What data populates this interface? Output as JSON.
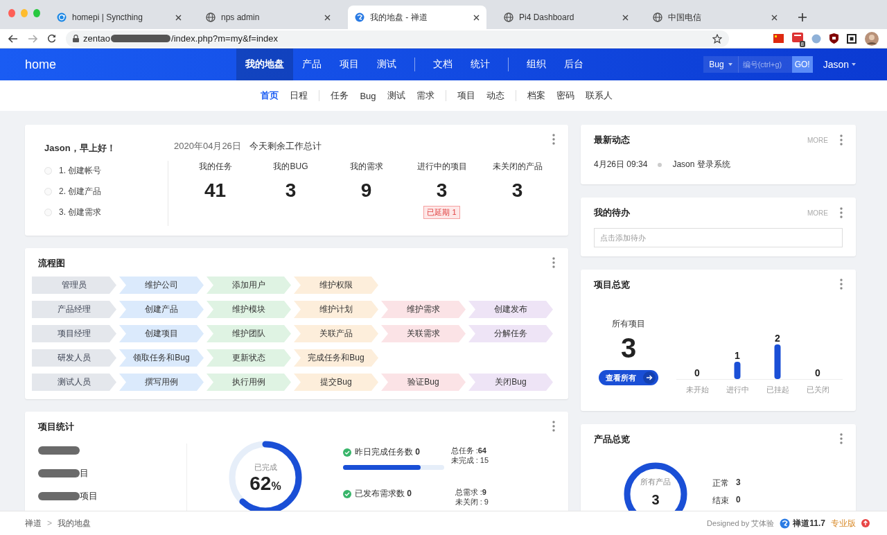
{
  "browser": {
    "tabs": [
      {
        "title": "homepi | Syncthing",
        "kind": "syncthing",
        "selected": false
      },
      {
        "title": "nps admin",
        "kind": "globe",
        "selected": false
      },
      {
        "title": "我的地盘 - 禅道",
        "kind": "zentao",
        "selected": true
      },
      {
        "title": "Pi4 Dashboard",
        "kind": "globe",
        "selected": false
      },
      {
        "title": "中国电信",
        "kind": "globe",
        "selected": false
      }
    ],
    "url": {
      "start": "zentao",
      "redacted": true,
      "path": "/index.php?m=my&f=index"
    },
    "extension_badge": "8"
  },
  "header": {
    "brand": "home",
    "nav_groups": [
      [
        {
          "label": "我的地盘",
          "selected": true
        },
        {
          "label": "产品",
          "selected": false
        },
        {
          "label": "项目",
          "selected": false
        },
        {
          "label": "测试",
          "selected": false
        }
      ],
      [
        {
          "label": "文档",
          "selected": false
        },
        {
          "label": "统计",
          "selected": false
        }
      ],
      [
        {
          "label": "组织",
          "selected": false
        },
        {
          "label": "后台",
          "selected": false
        }
      ]
    ],
    "search": {
      "type": "Bug",
      "placeholder": "编号(ctrl+g)",
      "button": "GO!"
    },
    "user": "Jason"
  },
  "subnav": {
    "groups": [
      [
        {
          "label": "首页",
          "selected": true
        },
        {
          "label": "日程",
          "selected": false
        }
      ],
      [
        {
          "label": "任务",
          "selected": false
        },
        {
          "label": "Bug",
          "selected": false
        },
        {
          "label": "测试",
          "selected": false
        },
        {
          "label": "需求",
          "selected": false
        }
      ],
      [
        {
          "label": "项目",
          "selected": false
        },
        {
          "label": "动态",
          "selected": false
        }
      ],
      [
        {
          "label": "档案",
          "selected": false
        },
        {
          "label": "密码",
          "selected": false
        },
        {
          "label": "联系人",
          "selected": false
        }
      ]
    ]
  },
  "welcome": {
    "greeting": "Jason，早上好！",
    "steps": [
      {
        "label": "1. 创建帐号",
        "done": false
      },
      {
        "label": "2. 创建产品",
        "done": false
      },
      {
        "label": "3. 创建需求",
        "done": false
      }
    ],
    "date": "2020年04月26日",
    "summary_title": "今天剩余工作总计",
    "stats": [
      {
        "label": "我的任务",
        "value": "41"
      },
      {
        "label": "我的BUG",
        "value": "3"
      },
      {
        "label": "我的需求",
        "value": "9"
      },
      {
        "label": "进行中的项目",
        "value": "3",
        "badge": "已延期 1"
      },
      {
        "label": "未关闭的产品",
        "value": "3"
      }
    ]
  },
  "flowchart": {
    "title": "流程图",
    "rows": [
      {
        "role": "管理员",
        "steps": [
          "维护公司",
          "添加用户",
          "维护权限"
        ]
      },
      {
        "role": "产品经理",
        "steps": [
          "创建产品",
          "维护模块",
          "维护计划",
          "维护需求",
          "创建发布"
        ]
      },
      {
        "role": "项目经理",
        "steps": [
          "创建项目",
          "维护团队",
          "关联产品",
          "关联需求",
          "分解任务"
        ]
      },
      {
        "role": "研发人员",
        "steps": [
          "领取任务和Bug",
          "更新状态",
          "完成任务和Bug"
        ]
      },
      {
        "role": "测试人员",
        "steps": [
          "撰写用例",
          "执行用例",
          "提交Bug",
          "验证Bug",
          "关闭Bug"
        ]
      }
    ]
  },
  "project_stats": {
    "title": "项目统计",
    "projects": [
      {
        "redacted": true
      },
      {
        "redacted": true,
        "name": "目"
      },
      {
        "redacted": true,
        "name": "项目"
      }
    ],
    "progress": {
      "label": "已完成",
      "percent": "62",
      "unit": "%",
      "level": 0.62
    },
    "metrics": [
      {
        "text": "昨日完成任务数 **0**",
        "level": 0.77,
        "totals": [
          "总任务 :**64**",
          "未完成 : 15"
        ]
      },
      {
        "text": "已发布需求数 **0**",
        "totals": [
          "总需求 :**9**",
          "未关闭 : 9"
        ]
      }
    ]
  },
  "activity": {
    "title": "最新动态",
    "more": "MORE",
    "items": [
      {
        "time": "4月26日 09:34",
        "text": "Jason 登录系统"
      }
    ]
  },
  "todo": {
    "title": "我的待办",
    "more": "MORE",
    "placeholder": "点击添加待办"
  },
  "project_overview": {
    "title": "项目总览",
    "total_label": "所有项目",
    "total": "3",
    "button": "查看所有",
    "chart_data": {
      "type": "bar",
      "categories": [
        "未开始",
        "进行中",
        "已挂起",
        "已关闭"
      ],
      "values": [
        0,
        1,
        2,
        0
      ],
      "data_labels": true
    }
  },
  "product_overview": {
    "title": "产品总览",
    "total_label": "所有产品",
    "total": "3",
    "legend": [
      {
        "label": "正常",
        "value": "3"
      },
      {
        "label": "结束",
        "value": "0"
      }
    ]
  },
  "footer": {
    "breadcrumb": [
      "禅道",
      "我的地盘"
    ],
    "separator": ">",
    "designed_by": "Designed by 艾体验",
    "version": "禅道11.7",
    "edition": "专业版"
  }
}
